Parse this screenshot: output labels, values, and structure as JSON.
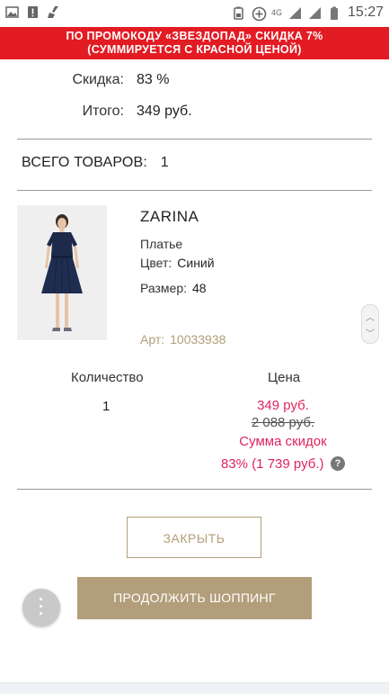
{
  "status_bar": {
    "time": "15:27",
    "network": "4G",
    "icons": [
      "image-icon",
      "alert-icon",
      "broom-icon",
      "battery-saver-icon",
      "add-circle-icon",
      "signal-icon",
      "signal-icon",
      "battery-icon"
    ]
  },
  "promo": {
    "line1": "ПО ПРОМОКОДУ «ЗВЕЗДОПАД» СКИДКА 7%",
    "line2": "(СУММИРУЕТСЯ С КРАСНОЙ ЦЕНОЙ)",
    "color": "#e31b23"
  },
  "summary": {
    "discount_label": "Скидка:",
    "discount_value": "83 %",
    "total_label": "Итого:",
    "total_value": "349 руб."
  },
  "total_goods": {
    "label": "ВСЕГО ТОВАРОВ:",
    "count": "1"
  },
  "product": {
    "brand": "ZARINA",
    "type": "Платье",
    "color_label": "Цвет:",
    "color_value": "Синий",
    "size_label": "Размер:",
    "size_value": "48",
    "art_label": "Арт:",
    "art_value": "10033938",
    "accent_color": "#b29e7a"
  },
  "pricing": {
    "qty_header": "Количество",
    "price_header": "Цена",
    "qty_value": "1",
    "price_now": "349 руб.",
    "price_old": "2 088 руб.",
    "discount_sum_label": "Сумма скидок",
    "discount_sum_value": "83% (1 739 руб.)",
    "price_color": "#e0245e"
  },
  "buttons": {
    "close": "ЗАКРЫТЬ",
    "continue": "ПРОДОЛЖИТЬ ШОППИНГ"
  }
}
